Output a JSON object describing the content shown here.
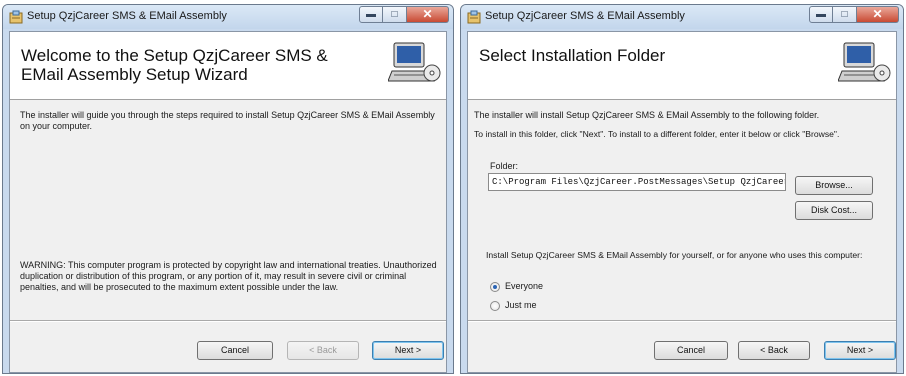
{
  "window1": {
    "title": "Setup QzjCareer SMS & EMail Assembly",
    "heading": "Welcome to the Setup QzjCareer SMS & EMail Assembly Setup Wizard",
    "intro_text": "The installer will guide you through the steps required to install Setup QzjCareer SMS & EMail Assembly on your computer.",
    "warning_text": "WARNING: This computer program is protected by copyright law and international treaties. Unauthorized duplication or distribution of this program, or any portion of it, may result in severe civil or criminal penalties, and will be prosecuted to the maximum extent possible under the law.",
    "buttons": {
      "cancel": "Cancel",
      "back": "< Back",
      "next": "Next >"
    }
  },
  "window2": {
    "title": "Setup QzjCareer SMS & EMail Assembly",
    "heading": "Select Installation Folder",
    "line1": "The installer will install Setup QzjCareer SMS & EMail Assembly to the following folder.",
    "line2": "To install in this folder, click \"Next\". To install to a different folder, enter it below or click \"Browse\".",
    "folder_label": "Folder:",
    "folder_value": "C:\\Program Files\\QzjCareer.PostMessages\\Setup QzjCareer",
    "browse": "Browse...",
    "disk_cost": "Disk Cost...",
    "install_for": "Install Setup QzjCareer SMS & EMail Assembly for yourself, or for anyone who uses this computer:",
    "radio_everyone": "Everyone",
    "radio_justme": "Just me",
    "buttons": {
      "cancel": "Cancel",
      "back": "< Back",
      "next": "Next >"
    }
  },
  "icons": {
    "app": "installer-app-icon",
    "banner": "computer-cd-icon"
  },
  "colors": {
    "titlebar": "#c9daee",
    "close_button": "#c94a33",
    "dialog_bg": "#f0f0f0",
    "banner_bg": "#ffffff"
  }
}
